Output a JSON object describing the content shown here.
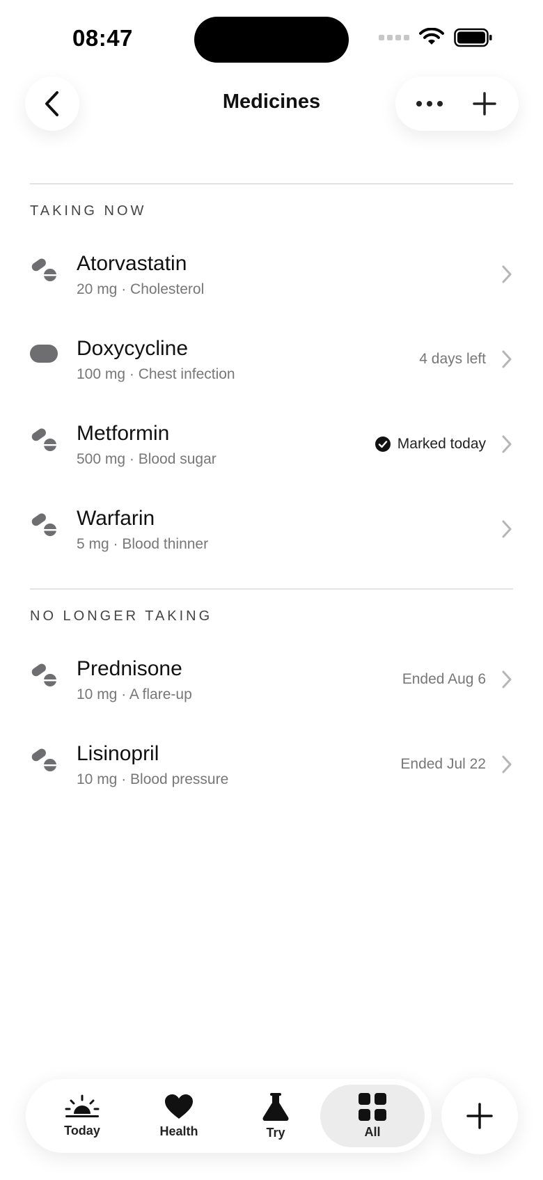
{
  "status_bar": {
    "time": "08:47"
  },
  "header": {
    "title": "Medicines"
  },
  "sections": [
    {
      "title": "TAKING NOW",
      "items": [
        {
          "name": "Atorvastatin",
          "detail": "20 mg · Cholesterol",
          "trailing": "",
          "icon": "pills-icon"
        },
        {
          "name": "Doxycycline",
          "detail": "100 mg · Chest infection",
          "trailing": "4 days left",
          "icon": "capsule-icon"
        },
        {
          "name": "Metformin",
          "detail": "500 mg · Blood sugar",
          "trailing": "Marked today",
          "icon": "pills-icon",
          "marked": true
        },
        {
          "name": "Warfarin",
          "detail": "5 mg · Blood thinner",
          "trailing": "",
          "icon": "pills-icon"
        }
      ]
    },
    {
      "title": "NO LONGER TAKING",
      "items": [
        {
          "name": "Prednisone",
          "detail": "10 mg · A flare-up",
          "trailing": "Ended Aug 6",
          "icon": "pills-icon"
        },
        {
          "name": "Lisinopril",
          "detail": "10 mg · Blood pressure",
          "trailing": "Ended Jul 22",
          "icon": "pills-icon"
        }
      ]
    }
  ],
  "tabbar": {
    "tabs": [
      {
        "label": "Today",
        "icon": "sunrise-icon"
      },
      {
        "label": "Health",
        "icon": "heart-icon"
      },
      {
        "label": "Try",
        "icon": "flask-icon"
      },
      {
        "label": "All",
        "icon": "grid-icon",
        "active": true
      }
    ]
  },
  "colors": {
    "icon_gray": "#6e6e70",
    "text_secondary": "#777777",
    "divider": "#e3e3e3",
    "active_tab_bg": "#ececec"
  }
}
